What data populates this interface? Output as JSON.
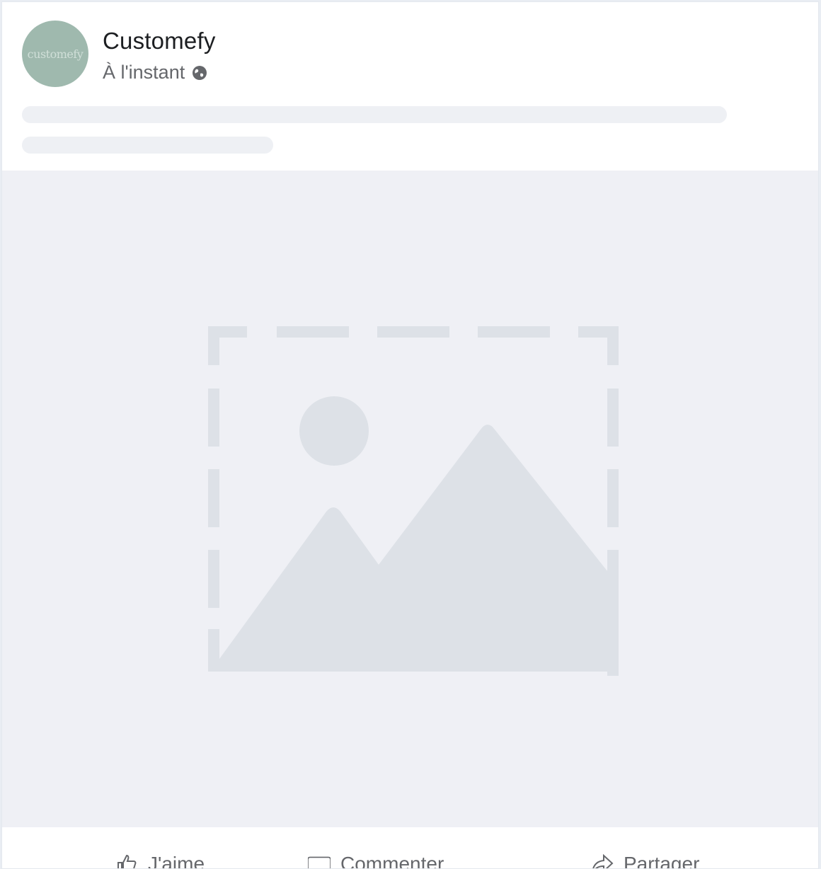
{
  "post": {
    "page_name": "Customefy",
    "avatar_text": "customefy",
    "time": "À l'instant",
    "privacy_icon": "globe-icon",
    "media_icon": "image-placeholder-icon"
  },
  "actions": [
    {
      "label": "J'aime",
      "icon": "like-icon"
    },
    {
      "label": "Commenter",
      "icon": "comment-icon"
    },
    {
      "label": "Partager",
      "icon": "share-icon"
    }
  ],
  "colors": {
    "avatar_bg": "#9fb9ae",
    "media_bg": "#eff0f5",
    "placeholder_shape": "#dde1e7",
    "skeleton": "#eef0f4"
  }
}
